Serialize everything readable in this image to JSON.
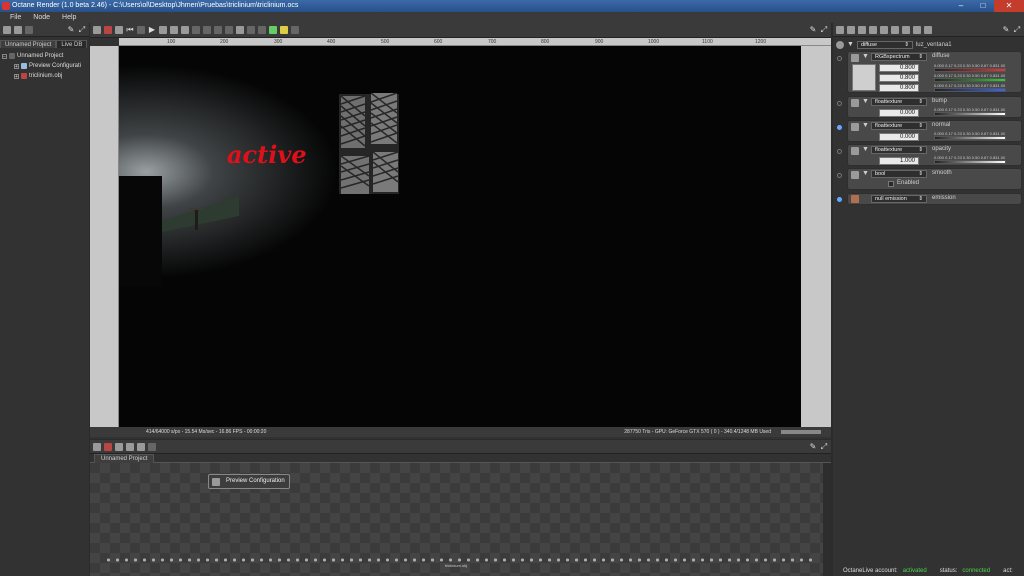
{
  "window": {
    "title": "Octane Render (1.0 beta 2.46) - C:\\Users\\ol\\Desktop\\Jhmen\\Pruebas\\triclinium\\triclinium.ocs",
    "controls": [
      "–",
      "□",
      "✕"
    ]
  },
  "menu": [
    "File",
    "Node",
    "Help"
  ],
  "left_panel": {
    "tabs": [
      "Unnamed Project",
      "Live DB"
    ],
    "tree": [
      {
        "label": "Unnamed Project",
        "level": 0
      },
      {
        "label": "Preview Configurati",
        "level": 1
      },
      {
        "label": "triclinium.obj",
        "level": 1
      }
    ]
  },
  "viewport": {
    "ruler_ticks": [
      "100",
      "200",
      "300",
      "400",
      "500",
      "600",
      "700",
      "800",
      "900",
      "1000",
      "1100",
      "1200"
    ],
    "overlay_text": "active",
    "status_left": "414/64000 s/px - 15.54 Ms/sec - 16.86 FPS - 00:00:20",
    "status_right": "287750 Tris - GPU: GeForce GTX 570 ( 0 ) - 340.4/1248 MB Used"
  },
  "node_graph": {
    "tab": "Unnamed Project",
    "node_label": "Preview Configuration",
    "bottom_label": "triclinium.obj"
  },
  "inspector": {
    "header_type": "diffuse",
    "header_name": "luz_ventana1",
    "ticks": "0.000 0.17 0.23 0.30 0.50 0.67 0.831.00",
    "pins": [
      {
        "type": "RGBspectrum",
        "name": "diffuse",
        "values": [
          "0.800",
          "0.800",
          "0.800"
        ]
      },
      {
        "type": "floattexture",
        "name": "bump",
        "value": "0.000"
      },
      {
        "type": "floattexture",
        "name": "normal",
        "value": "0.000"
      },
      {
        "type": "floattexture",
        "name": "opacity",
        "value": "1.000"
      },
      {
        "type": "bool",
        "name": "smooth",
        "checkbox_label": "Enabled"
      },
      {
        "type": "null emission",
        "name": "emission"
      }
    ]
  },
  "footer": {
    "account_label": "OctaneLive account:",
    "account_value": "activated",
    "status_label": "status:",
    "status_value": "connected",
    "act_label": "act:"
  },
  "colors": {
    "overlay_text": "#e0101a",
    "connected": "#4ed14e",
    "title_bar": "#2f5d9a"
  }
}
